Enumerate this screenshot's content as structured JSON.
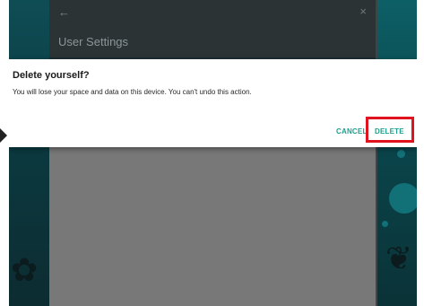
{
  "background_screen": {
    "header": {
      "back_icon": "arrow-back-icon",
      "close_icon": "close-icon",
      "title": "User Settings"
    }
  },
  "dialog": {
    "title": "Delete yourself?",
    "message": "You will lose your space and data on this device. You can't undo this action.",
    "buttons": {
      "cancel_label": "CANCEL",
      "delete_label": "DELETE"
    }
  },
  "colors": {
    "accent": "#1e9e8e",
    "highlight": "#e0141e",
    "scrim": "#1d2e33",
    "dialog_bg": "#ffffff"
  }
}
